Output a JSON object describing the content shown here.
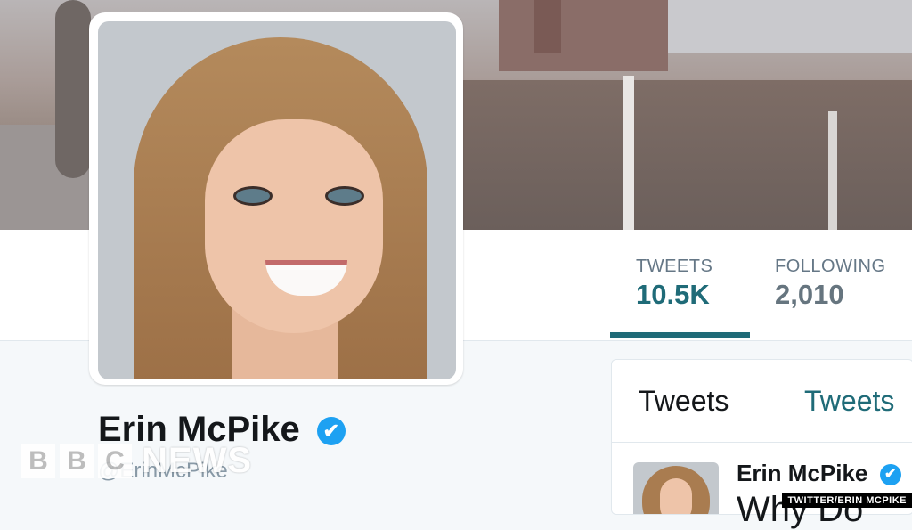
{
  "profile": {
    "name": "Erin McPike",
    "handle": "@ErinMcPike",
    "verified_symbol": "✔"
  },
  "nav": {
    "stats": [
      {
        "label": "TWEETS",
        "value": "10.5K",
        "active": true
      },
      {
        "label": "FOLLOWING",
        "value": "2,010",
        "active": false
      }
    ]
  },
  "timeline": {
    "tabs": [
      "Tweets",
      "Tweets"
    ],
    "tweet": {
      "author": "Erin McPike",
      "text_partial": "Why Do"
    }
  },
  "watermark": {
    "letters": [
      "B",
      "B",
      "C"
    ],
    "word": "NEWS"
  },
  "credit": "TWITTER/ERIN MCPIKE",
  "colors": {
    "accent": "#1f6b78",
    "verified": "#1da1f2",
    "muted": "#657786"
  },
  "icons": [
    "verified-badge-icon"
  ]
}
